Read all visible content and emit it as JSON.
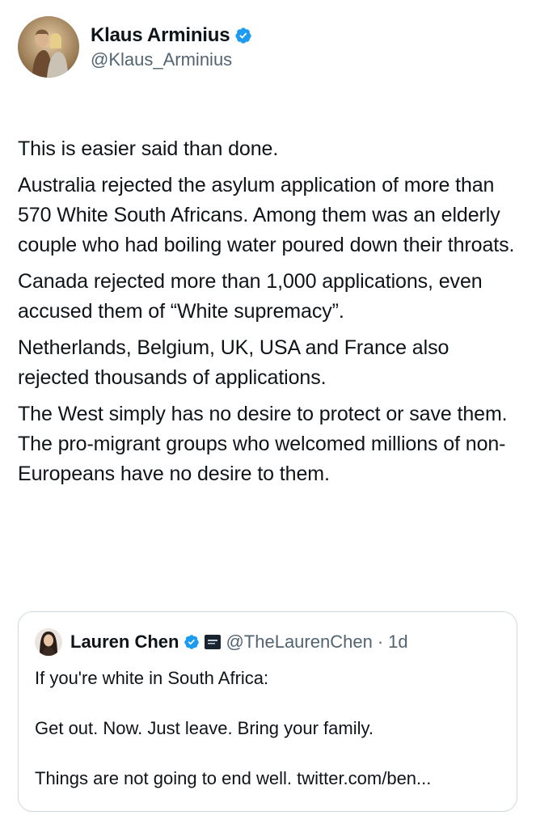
{
  "author": {
    "display_name": "Klaus Arminius",
    "handle": "@Klaus_Arminius",
    "avatar_icon": "profile-photo",
    "verified_icon": "verified-badge-icon",
    "verified_color": "#1d9bf0"
  },
  "tweet": {
    "paragraphs": [
      "This is easier said than done.",
      "Australia rejected the asylum application of more than 570 White South Africans. Among them was an elderly couple who had boiling water poured down their throats.",
      "Canada rejected more than 1,000 applications, even accused them of “White supremacy”.",
      "Netherlands, Belgium, UK, USA and France also rejected thousands of applications.",
      "The West simply has no desire to protect or save them. The pro-migrant groups who welcomed millions of non-Europeans have no desire to them."
    ]
  },
  "quote": {
    "display_name": "Lauren Chen",
    "handle": "@TheLaurenChen",
    "separator": "·",
    "time": "1d",
    "verified_icon": "verified-badge-icon",
    "affiliate_icon": "affiliate-badge-icon",
    "lines": [
      "If you're white in South Africa:",
      "Get out. Now. Just leave. Bring your family.",
      "Things are not going to end well. twitter.com/ben..."
    ]
  }
}
